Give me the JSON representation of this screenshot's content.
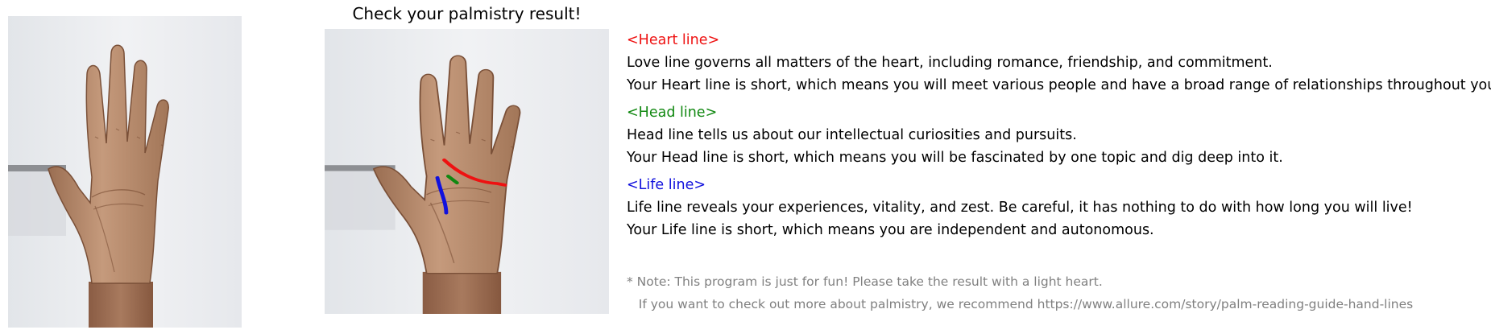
{
  "title": "Check your palmistry result!",
  "images": {
    "original": "hand-photo",
    "result": "hand-photo-with-detected-lines"
  },
  "colors": {
    "heart": "#ee1111",
    "head": "#118811",
    "life": "#1111dd",
    "note": "#808080"
  },
  "sections": [
    {
      "heading": "<Heart line>",
      "description": "Love line governs all matters of the heart, including romance, friendship, and commitment.",
      "result": "Your Heart line is short, which means you will meet various people and have a broad range of relationships throughout your life."
    },
    {
      "heading": "<Head line>",
      "description": "Head line tells us about our intellectual curiosities and pursuits.",
      "result": "Your Head line is short, which means you will be fascinated by one topic and dig deep into it."
    },
    {
      "heading": "<Life line>",
      "description": "Life line reveals your experiences, vitality, and zest. Be careful, it has nothing to do with how long you will live!",
      "result": "Your Life line is short, which means you are independent and autonomous."
    }
  ],
  "note": {
    "line1": "* Note: This program is just for fun! Please take the result with a light heart.",
    "line2": "   If you want to check out more about palmistry, we recommend https://www.allure.com/story/palm-reading-guide-hand-lines"
  }
}
